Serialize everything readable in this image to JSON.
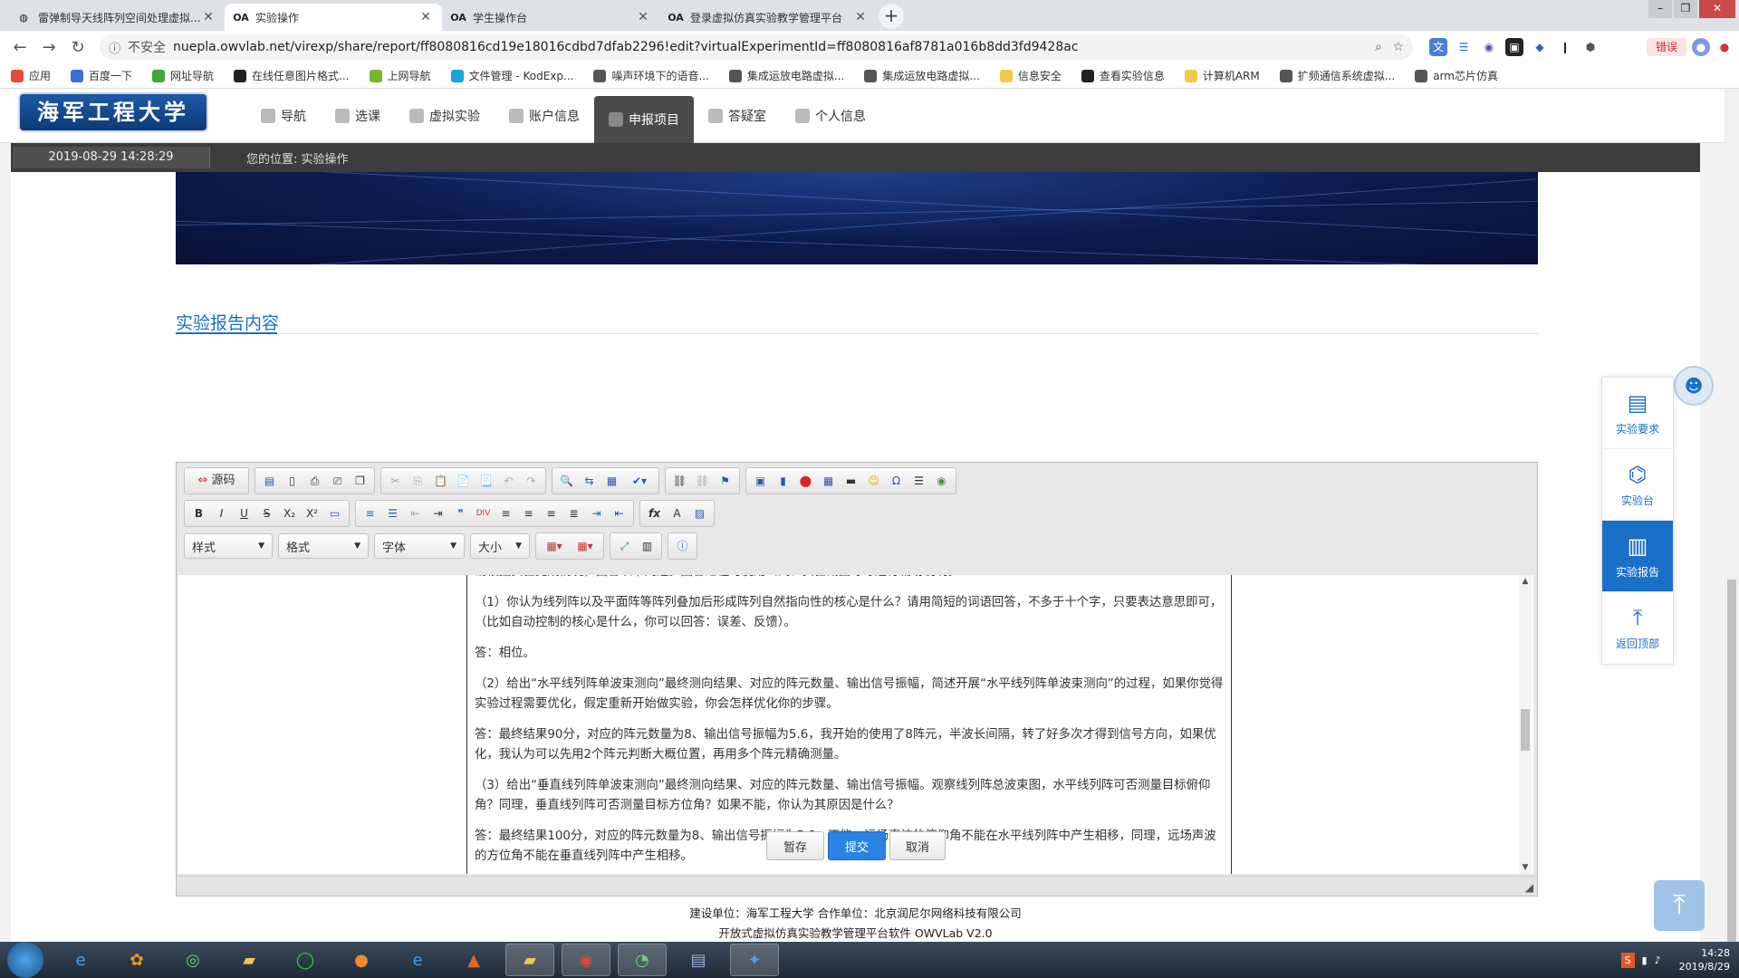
{
  "browser": {
    "tabs": [
      {
        "title": "雷弹制导天线阵列空间处理虚拟...",
        "icon": "globe-icon",
        "active": false
      },
      {
        "title": "实验操作",
        "icon": "oa-icon",
        "active": true
      },
      {
        "title": "学生操作台",
        "icon": "oa-icon",
        "active": false
      },
      {
        "title": "登录虚拟仿真实验教学管理平台",
        "icon": "oa-icon",
        "active": false
      }
    ],
    "new_tab": "+",
    "insecure_label": "不安全",
    "url": "nuepla.owvlab.net/virexp/share/report/ff8080816cd19e18016cdbd7dfab2296!edit?virtualExperimentId=ff8080816af8781a016b8dd3fd9428ac",
    "paused_label": "错误",
    "bookmarks": [
      {
        "label": "应用",
        "color": "#e84a3c"
      },
      {
        "label": "百度一下",
        "color": "#3b6fd8"
      },
      {
        "label": "网址导航",
        "color": "#3ea83a"
      },
      {
        "label": "在线任意图片格式...",
        "color": "#222222"
      },
      {
        "label": "上网导航",
        "color": "#79b62c"
      },
      {
        "label": "文件管理 - KodExp...",
        "color": "#1aa3d8"
      },
      {
        "label": "噪声环境下的语音...",
        "color": "#555555"
      },
      {
        "label": "集成运放电路虚拟...",
        "color": "#555555"
      },
      {
        "label": "集成运放电路虚拟...",
        "color": "#555555"
      },
      {
        "label": "信息安全",
        "color": "#f2c94c"
      },
      {
        "label": "查看实验信息",
        "color": "#222222"
      },
      {
        "label": "计算机ARM",
        "color": "#f2c94c"
      },
      {
        "label": "扩频通信系统虚拟...",
        "color": "#555555"
      },
      {
        "label": "arm芯片仿真",
        "color": "#555555"
      }
    ]
  },
  "site": {
    "logo_text": "海军工程大学",
    "menu": [
      {
        "label": "导航",
        "active": false
      },
      {
        "label": "选课",
        "active": false
      },
      {
        "label": "虚拟实验",
        "active": false
      },
      {
        "label": "账户信息",
        "active": false
      },
      {
        "label": "申报项目",
        "active": true
      },
      {
        "label": "答疑室",
        "active": false
      },
      {
        "label": "个人信息",
        "active": false
      }
    ],
    "datetime": "2019-08-29    14:28:29",
    "location": "您的位置: 实验操作"
  },
  "report": {
    "section_title": "实验报告内容",
    "toolbar": {
      "source_label": "源码",
      "style_select": "样式",
      "format_select": "格式",
      "font_select": "字体",
      "size_select": "大小"
    },
    "cut_line": "请根据实验完成情况，回答以下问题。回答过程可使用公式、实验截图等等进行辅助说明。",
    "paragraphs": [
      "（1）你认为线列阵以及平面阵等阵列叠加后形成阵列自然指向性的核心是什么？请用简短的词语回答，不多于十个字，只要表达意思即可，（比如自动控制的核心是什么，你可以回答：误差、反馈）。",
      "答：相位。",
      "（2）给出“水平线列阵单波束测向”最终测向结果、对应的阵元数量、输出信号振幅，简述开展“水平线列阵单波束测向”的过程，如果你觉得实验过程需要优化，假定重新开始做实验，你会怎样优化你的步骤。",
      "答：最终结果90分，对应的阵元数量为8、输出信号振幅为5.6，我开始的使用了8阵元，半波长间隔，转了好多次才得到信号方向，如果优化，我认为可以先用2个阵元判断大概位置，再用多个阵元精确测量。",
      "（3）给出“垂直线列阵单波束测向”最终测向结果、对应的阵元数量、输出信号振幅。观察线列阵总波束图，水平线列阵可否测量目标俯仰角？同理，垂直线列阵可否测量目标方位角？如果不能，你认为其原因是什么？",
      "答：最终结果100分，对应的阵元数量为8、输出信号振幅为5.8。不能，远场声波的俯仰角不能在水平线列阵中产生相移，同理，远场声波的方位角不能在垂直线列阵中产生相移。"
    ],
    "buttons": {
      "save": "暂存",
      "submit": "提交",
      "cancel": "取消"
    }
  },
  "footer": {
    "line1": "建设单位：海军工程大学    合作单位：北京润尼尔网络科技有限公司",
    "line2": "开放式虚拟仿真实验教学管理平台软件 OWVLab V2.0"
  },
  "side_panel": [
    {
      "label": "实验要求",
      "icon": "document-icon",
      "active": false
    },
    {
      "label": "实验台",
      "icon": "workbench-icon",
      "active": false
    },
    {
      "label": "实验报告",
      "icon": "chart-report-icon",
      "active": true
    },
    {
      "label": "返回顶部",
      "icon": "arrow-up-icon",
      "active": false
    }
  ],
  "taskbar": {
    "clock_time": "14:28",
    "clock_date": "2019/8/29"
  }
}
